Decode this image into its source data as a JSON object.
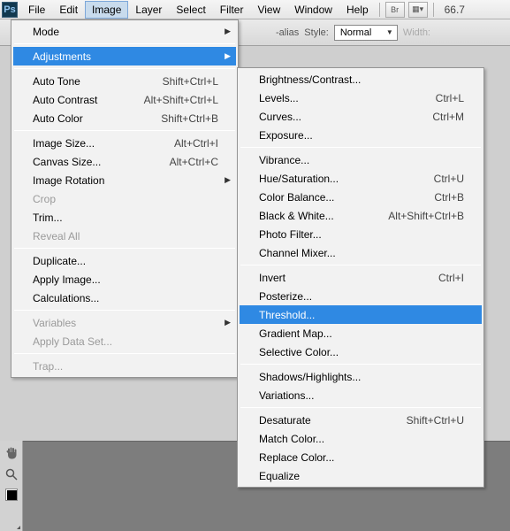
{
  "menubar": {
    "items": [
      "File",
      "Edit",
      "Image",
      "Layer",
      "Select",
      "Filter",
      "View",
      "Window",
      "Help"
    ],
    "open_index": 2,
    "btn1": "Br",
    "btn2": "▦",
    "zoom": "66.7"
  },
  "optbar": {
    "aa_label": "-alias",
    "style_label": "Style:",
    "style_value": "Normal",
    "width_label": "Width:"
  },
  "image_menu": [
    {
      "label": "Mode",
      "arrow": true
    },
    {
      "sep": true
    },
    {
      "label": "Adjustments",
      "arrow": true,
      "hl": true
    },
    {
      "sep": true
    },
    {
      "label": "Auto Tone",
      "shortcut": "Shift+Ctrl+L"
    },
    {
      "label": "Auto Contrast",
      "shortcut": "Alt+Shift+Ctrl+L"
    },
    {
      "label": "Auto Color",
      "shortcut": "Shift+Ctrl+B"
    },
    {
      "sep": true
    },
    {
      "label": "Image Size...",
      "shortcut": "Alt+Ctrl+I"
    },
    {
      "label": "Canvas Size...",
      "shortcut": "Alt+Ctrl+C"
    },
    {
      "label": "Image Rotation",
      "arrow": true
    },
    {
      "label": "Crop",
      "dim": true
    },
    {
      "label": "Trim..."
    },
    {
      "label": "Reveal All",
      "dim": true
    },
    {
      "sep": true
    },
    {
      "label": "Duplicate..."
    },
    {
      "label": "Apply Image..."
    },
    {
      "label": "Calculations..."
    },
    {
      "sep": true
    },
    {
      "label": "Variables",
      "arrow": true,
      "dim": true
    },
    {
      "label": "Apply Data Set...",
      "dim": true
    },
    {
      "sep": true
    },
    {
      "label": "Trap...",
      "dim": true
    }
  ],
  "adjustments_menu": [
    {
      "label": "Brightness/Contrast..."
    },
    {
      "label": "Levels...",
      "shortcut": "Ctrl+L"
    },
    {
      "label": "Curves...",
      "shortcut": "Ctrl+M"
    },
    {
      "label": "Exposure..."
    },
    {
      "sep": true
    },
    {
      "label": "Vibrance..."
    },
    {
      "label": "Hue/Saturation...",
      "shortcut": "Ctrl+U"
    },
    {
      "label": "Color Balance...",
      "shortcut": "Ctrl+B"
    },
    {
      "label": "Black & White...",
      "shortcut": "Alt+Shift+Ctrl+B"
    },
    {
      "label": "Photo Filter..."
    },
    {
      "label": "Channel Mixer..."
    },
    {
      "sep": true
    },
    {
      "label": "Invert",
      "shortcut": "Ctrl+I"
    },
    {
      "label": "Posterize..."
    },
    {
      "label": "Threshold...",
      "hl": true
    },
    {
      "label": "Gradient Map..."
    },
    {
      "label": "Selective Color..."
    },
    {
      "sep": true
    },
    {
      "label": "Shadows/Highlights..."
    },
    {
      "label": "Variations..."
    },
    {
      "sep": true
    },
    {
      "label": "Desaturate",
      "shortcut": "Shift+Ctrl+U"
    },
    {
      "label": "Match Color..."
    },
    {
      "label": "Replace Color..."
    },
    {
      "label": "Equalize"
    }
  ],
  "tools": {
    "hand": "✋",
    "zoom": "🔍"
  }
}
